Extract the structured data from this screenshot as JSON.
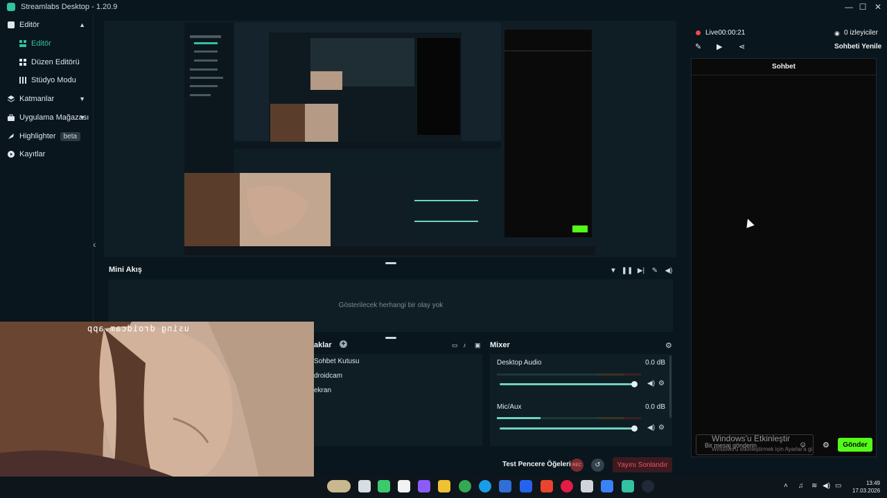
{
  "window": {
    "title": "Streamlabs Desktop - 1.20.9",
    "controls": [
      "—",
      "☐",
      "✕"
    ]
  },
  "sidebar": {
    "items": [
      {
        "label": "Editör",
        "icon": "editor-icon",
        "expanded": true
      },
      {
        "label": "Editör",
        "icon": "editor-sub-icon",
        "active": true
      },
      {
        "label": "Düzen Editörü",
        "icon": "layout-icon"
      },
      {
        "label": "Stüdyo Modu",
        "icon": "studio-icon"
      },
      {
        "label": "Katmanlar",
        "icon": "layers-icon"
      },
      {
        "label": "Uygulama Mağazası",
        "icon": "store-icon"
      },
      {
        "label": "Highlighter",
        "icon": "highlighter-icon",
        "badge": "beta"
      },
      {
        "label": "Kayıtlar",
        "icon": "recordings-icon"
      }
    ]
  },
  "minifeed": {
    "title": "Mini Akış",
    "empty": "Gösterilecek herhangi bir olay yok"
  },
  "sources": {
    "title": "aklar",
    "items": [
      "Sohbet Kutusu",
      "droidcam",
      "ekran"
    ]
  },
  "mixer": {
    "title": "Mixer",
    "channels": [
      {
        "name": "Desktop Audio",
        "db": "0.0 dB",
        "level": 0.0,
        "volume": 1.0
      },
      {
        "name": "Mic/Aux",
        "db": "0.0 dB",
        "level": 0.3,
        "volume": 1.0
      }
    ]
  },
  "controls": {
    "test_label": "Test Pencere Öğeleri",
    "rec": "REC",
    "end_stream": "Yayını Sonlandır"
  },
  "webcam": {
    "overlay_text": "using droidcam.app"
  },
  "stream": {
    "status": "Live",
    "time": "00:00:21",
    "viewers": "0 izleyiciler",
    "refresh_chat": "Sohbeti Yenile"
  },
  "chat": {
    "title": "Sohbet",
    "placeholder": "Bir mesaj gönderin",
    "send": "Gönder"
  },
  "watermark": {
    "line1": "Windows'u Etkinleştir",
    "line2": "Windows'u etkinleştirmek için Ayarlar'a gi"
  },
  "taskbar": {
    "time": "13:49",
    "date": "17.03.2026"
  },
  "colors": {
    "accent": "#31c3a2",
    "live": "#f4474d",
    "kick_green": "#53fc18",
    "danger": "#f0545b"
  }
}
